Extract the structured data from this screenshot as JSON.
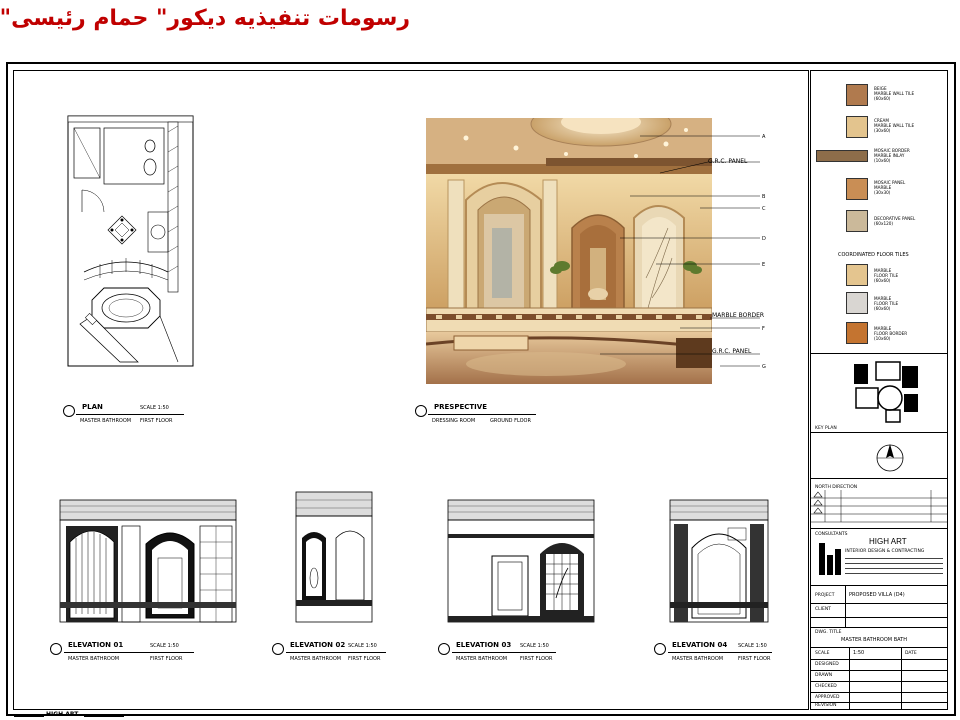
{
  "page": {
    "title": "رسومات تنفيذيه ديكور\" حمام رئيسى\""
  },
  "drawings": {
    "plan": {
      "label": "PLAN",
      "scale": "SCALE 1:50",
      "sub_left": "MASTER BATHROOM",
      "sub_right": "FIRST FLOOR"
    },
    "perspective": {
      "label": "PRESPECTIVE",
      "sub_left": "DRESSING ROOM",
      "sub_right": "GROUND FLOOR",
      "callouts": [
        "G.R.C. PANEL",
        "MARBLE BORDER",
        "G.R.C. PANEL"
      ]
    },
    "elevations": [
      {
        "label": "ELEVATION 01",
        "scale": "SCALE 1:50",
        "sub_left": "MASTER BATHROOM",
        "sub_right": "FIRST FLOOR"
      },
      {
        "label": "ELEVATION 02",
        "scale": "SCALE 1:50",
        "sub_left": "MASTER BATHROOM",
        "sub_right": "FIRST FLOOR"
      },
      {
        "label": "ELEVATION 03",
        "scale": "SCALE 1:50",
        "sub_left": "MASTER BATHROOM",
        "sub_right": "FIRST FLOOR"
      },
      {
        "label": "ELEVATION 04",
        "scale": "SCALE 1:50",
        "sub_left": "MASTER BATHROOM",
        "sub_right": "FIRST FLOOR"
      }
    ]
  },
  "legend": {
    "heading": "COORDINATED FLOOR TILES",
    "items": [
      {
        "text": "BEIGE\nMARBLE WALL TILE\n(60x60)",
        "color": "#b07a4e"
      },
      {
        "text": "CREAM\nMARBLE WALL TILE\n(30x60)",
        "color": "#e3c48e"
      },
      {
        "text": "MOSAIC BORDER\nMARBLE INLAY\n(10x60)",
        "color": "#8d6d4a"
      },
      {
        "text": "MOSAIC PANEL\nMARBLE\n(30x30)",
        "color": "#c98e55"
      },
      {
        "text": "DECORATIVE PANEL\n(60x120)",
        "color": "#cbb99a"
      },
      {
        "text": "MARBLE\nFLOOR TILE\n(60x60)",
        "color": "#e4c58f"
      },
      {
        "text": "MARBLE\nFLOOR TILE\n(60x60)",
        "color": "#d9d6d2"
      },
      {
        "text": "MARBLE\nFLOOR BORDER\n(10x60)",
        "color": "#c47430"
      }
    ]
  },
  "titleblock": {
    "key_plan_label": "KEY PLAN",
    "north_label": "NORTH DIRECTION",
    "company_heading": "CONSULTANTS",
    "company_name": "HIGH ART",
    "company_sub": "INTERIOR DESIGN & CONTRACTING",
    "project_label": "PROJECT",
    "project_value": "PROPOSED VILLA (D4)",
    "client_label": "CLIENT",
    "client_value": "",
    "drawing_label": "DWG. TITLE",
    "drawing_value": "MASTER BATHROOM BATH",
    "scale_label": "SCALE",
    "scale_value": "1:50",
    "date_label": "DATE",
    "rows": [
      "DESIGNED",
      "DRAWN",
      "CHECKED",
      "APPROVED",
      "REVISION"
    ]
  },
  "footer": {
    "label": "HIGH ART"
  }
}
